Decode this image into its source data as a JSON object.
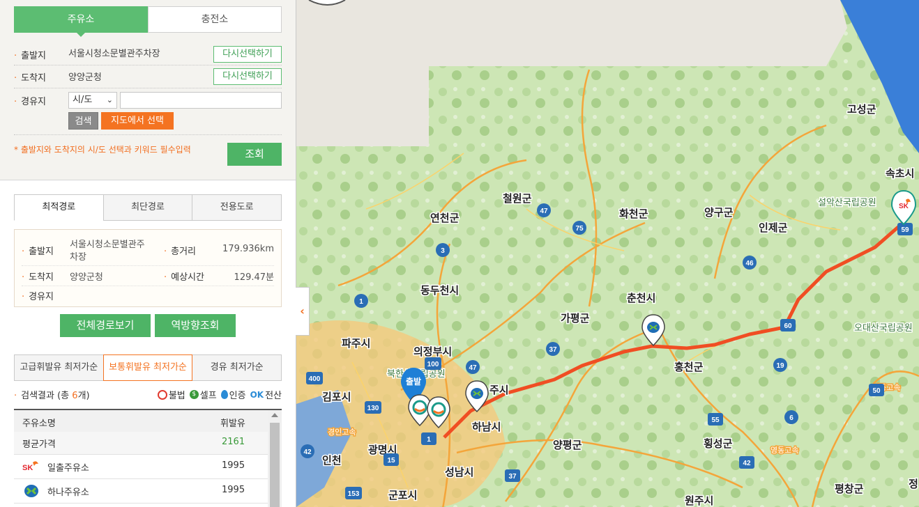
{
  "fuel_tabs": [
    {
      "label": "주유소"
    },
    {
      "label": "충전소"
    }
  ],
  "search": {
    "origin_label": "출발지",
    "origin_value": "서울시청소문별관주차장",
    "dest_label": "도착지",
    "dest_value": "양양군청",
    "reselect_label": "다시선택하기",
    "waypoint_label": "경유지",
    "region_select": "시/도",
    "search_button": "검색",
    "map_select_button": "지도에서 선택",
    "notice": "* 출발지와 도착지의 시/도 선택과 키워드 필수입력",
    "lookup_button": "조회"
  },
  "route_tabs": [
    {
      "label": "최적경로"
    },
    {
      "label": "최단경로"
    },
    {
      "label": "전용도로"
    }
  ],
  "route_info": {
    "origin_label": "출발지",
    "origin_value_line1": "서울시청소문별관주",
    "origin_value_line2": "차장",
    "distance_label": "총거리",
    "distance_value": "179.936km",
    "dest_label": "도착지",
    "dest_value": "양양군청",
    "time_label": "예상시간",
    "time_value": "129.47분",
    "waypoint_label": "경유지"
  },
  "actions": {
    "full_route": "전체경로보기",
    "reverse": "역방향조회"
  },
  "price_tabs": [
    {
      "label": "고급휘발유 최저가순"
    },
    {
      "label": "보통휘발유 최저가순"
    },
    {
      "label": "경유 최저가순"
    }
  ],
  "results": {
    "prefix": "검색결과 (총 ",
    "count": "6",
    "suffix": "개)",
    "legend": [
      {
        "label": "불법",
        "color": "#e03a2f",
        "icon": "prohibited-icon"
      },
      {
        "label": "셀프",
        "color": "#3a9a3a",
        "icon": "self-icon"
      },
      {
        "label": "인증",
        "color": "#2a8bd6",
        "icon": "drop-icon"
      },
      {
        "label": "전산",
        "color": "#2a8bd6",
        "icon": "ok-icon"
      }
    ]
  },
  "table": {
    "col_name": "주유소명",
    "col_price": "휘발유",
    "avg_label": "평균가격",
    "avg_price": "2161",
    "rows": [
      {
        "brand": "SK",
        "name": "일출주유소",
        "price": "1995"
      },
      {
        "brand": "hyundai",
        "name": "하나주유소",
        "price": "1995"
      }
    ]
  },
  "map": {
    "places": [
      "고성군",
      "속초시",
      "설악산국립공원",
      "철원군",
      "연천군",
      "화천군",
      "양구군",
      "인제군",
      "동두천시",
      "춘천시",
      "가평군",
      "오대산국립공원",
      "파주시",
      "의정부시",
      "북한산국립공원",
      "홍천군",
      "김포시",
      "주시",
      "하남시",
      "양평군",
      "횡성군",
      "인천",
      "광명시",
      "성남시",
      "군포시",
      "평창군",
      "원주시",
      "정",
      "출발"
    ],
    "road_labels": [
      "경인고속",
      "영동고속",
      "영동고속"
    ],
    "route_numbers": [
      "47",
      "75",
      "46",
      "3",
      "1",
      "60",
      "37",
      "19",
      "400",
      "100",
      "47",
      "50",
      "130",
      "6",
      "55",
      "1",
      "15",
      "42",
      "37",
      "42",
      "153",
      "59"
    ],
    "route_color": "#f04e23"
  }
}
